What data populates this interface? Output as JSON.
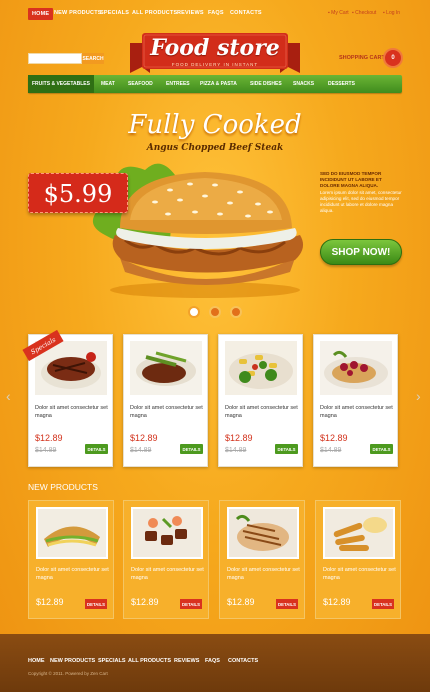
{
  "topnav": {
    "items": [
      "HOME",
      "NEW PRODUCTS",
      "SPECIALS",
      "ALL PRODUCTS",
      "REVIEWS",
      "FAQS",
      "CONTACTS"
    ],
    "links": [
      "My Cart",
      "Checkout",
      "Log In"
    ]
  },
  "search": {
    "button_label": "SEARCH",
    "placeholder": ""
  },
  "logo": {
    "title": "Food store",
    "subtitle": "FOOD DELIVERY IN INSTANT"
  },
  "cart": {
    "label": "SHOPPING CART",
    "count": "0"
  },
  "categories": [
    "FRUITS & VEGETABLES",
    "MEAT",
    "SEAFOOD",
    "ENTREES",
    "PIZZA & PASTA",
    "SIDE DISHES",
    "SNACKS",
    "DESSERTS"
  ],
  "hero": {
    "title": "Fully Cooked",
    "subtitle": "Angus Chopped Beef Steak",
    "price": "$5.99",
    "desc_highlight": "SED DO EIUSMOD TEMPOR INCIDIDUNT UT LABORE ET DOLORE MAGNA ALIQUA.",
    "desc_body": "Lorem ipsum dolor sit amet, consectetur adipisicing elit, sed do eiusmod tempor incididunt ut labore et dolore magna aliqua.",
    "cta": "SHOP NOW!",
    "slide_count": 3,
    "active_slide": 1
  },
  "specials": {
    "badge": "Specials",
    "items": [
      {
        "name": "Dolor sit  amet consectetur set magna",
        "price": "$12.89",
        "old_price": "$14.89",
        "button": "DETAILS"
      },
      {
        "name": "Dolor sit  amet consectetur set magna",
        "price": "$12.89",
        "old_price": "$14.89",
        "button": "DETAILS"
      },
      {
        "name": "Dolor sit  amet consectetur set magna",
        "price": "$12.89",
        "old_price": "$14.89",
        "button": "DETAILS"
      },
      {
        "name": "Dolor sit  amet consectetur set magna",
        "price": "$12.89",
        "old_price": "$14.89",
        "button": "DETAILS"
      }
    ]
  },
  "new_products": {
    "title": "NEW PRODUCTS",
    "items": [
      {
        "name": "Dolor sit  amet consectetur set magna",
        "price": "$12.89",
        "button": "DETAILS"
      },
      {
        "name": "Dolor sit  amet consectetur set magna",
        "price": "$12.89",
        "button": "DETAILS"
      },
      {
        "name": "Dolor sit  amet consectetur set magna",
        "price": "$12.89",
        "button": "DETAILS"
      },
      {
        "name": "Dolor sit  amet consectetur set magna",
        "price": "$12.89",
        "button": "DETAILS"
      }
    ]
  },
  "footer": {
    "nav": [
      "HOME",
      "NEW PRODUCTS",
      "SPECIALS",
      "ALL PRODUCTS",
      "REVIEWS",
      "FAQS",
      "CONTACTS"
    ],
    "copyright": "Copyright © 2011. Powered by Zen Cart"
  },
  "colors": {
    "accent_red": "#d9321e",
    "accent_green": "#4d9a1f",
    "background": "#f4a51c"
  }
}
